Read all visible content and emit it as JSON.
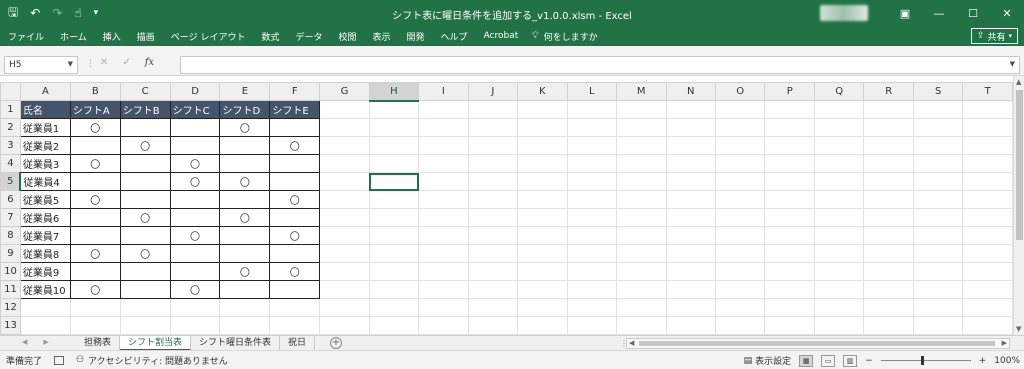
{
  "titlebar": {
    "title": "シフト表に曜日条件を追加する_v1.0.0.xlsm  -  Excel",
    "save_icon": "save-icon",
    "undo_icon": "undo-icon",
    "redo_icon": "redo-icon",
    "touch_icon": "touch-mode-icon",
    "customize_icon": "customize-qat-icon"
  },
  "ribbon": {
    "tabs": [
      "ファイル",
      "ホーム",
      "挿入",
      "描画",
      "ページ レイアウト",
      "数式",
      "データ",
      "校閲",
      "表示",
      "開発",
      "ヘルプ",
      "Acrobat"
    ],
    "search_label": "何をしますか",
    "share_label": "共有"
  },
  "formula_bar": {
    "name_box": "H5",
    "formula": ""
  },
  "columns": [
    "A",
    "B",
    "C",
    "D",
    "E",
    "F",
    "G",
    "H",
    "I",
    "J",
    "K",
    "L",
    "M",
    "N",
    "O",
    "P",
    "Q",
    "R",
    "S",
    "T"
  ],
  "selected_column": "H",
  "selected_row": 5,
  "rows": [
    1,
    2,
    3,
    4,
    5,
    6,
    7,
    8,
    9,
    10,
    11,
    12,
    13
  ],
  "table": {
    "header": [
      "氏名",
      "シフトA",
      "シフトB",
      "シフトC",
      "シフトD",
      "シフトE"
    ],
    "mark": "〇",
    "data": [
      {
        "name": "従業員1",
        "marks": [
          1,
          0,
          0,
          1,
          0
        ]
      },
      {
        "name": "従業員2",
        "marks": [
          0,
          1,
          0,
          0,
          1
        ]
      },
      {
        "name": "従業員3",
        "marks": [
          1,
          0,
          1,
          0,
          0
        ]
      },
      {
        "name": "従業員4",
        "marks": [
          0,
          0,
          1,
          1,
          0
        ]
      },
      {
        "name": "従業員5",
        "marks": [
          1,
          0,
          0,
          0,
          1
        ]
      },
      {
        "name": "従業員6",
        "marks": [
          0,
          1,
          0,
          1,
          0
        ]
      },
      {
        "name": "従業員7",
        "marks": [
          0,
          0,
          1,
          0,
          1
        ]
      },
      {
        "name": "従業員8",
        "marks": [
          1,
          1,
          0,
          0,
          0
        ]
      },
      {
        "name": "従業員9",
        "marks": [
          0,
          0,
          0,
          1,
          1
        ]
      },
      {
        "name": "従業員10",
        "marks": [
          1,
          0,
          1,
          0,
          0
        ]
      }
    ]
  },
  "sheets": [
    {
      "name": "担務表",
      "active": false
    },
    {
      "name": "シフト割当表",
      "active": true
    },
    {
      "name": "シフト曜日条件表",
      "active": false
    },
    {
      "name": "祝日",
      "active": false
    }
  ],
  "status": {
    "ready": "準備完了",
    "accessibility": "アクセシビリティ: 問題ありません",
    "display_settings": "表示設定",
    "zoom": "100%"
  },
  "colors": {
    "excel_green": "#217346",
    "table_header_bg": "#44546a"
  }
}
